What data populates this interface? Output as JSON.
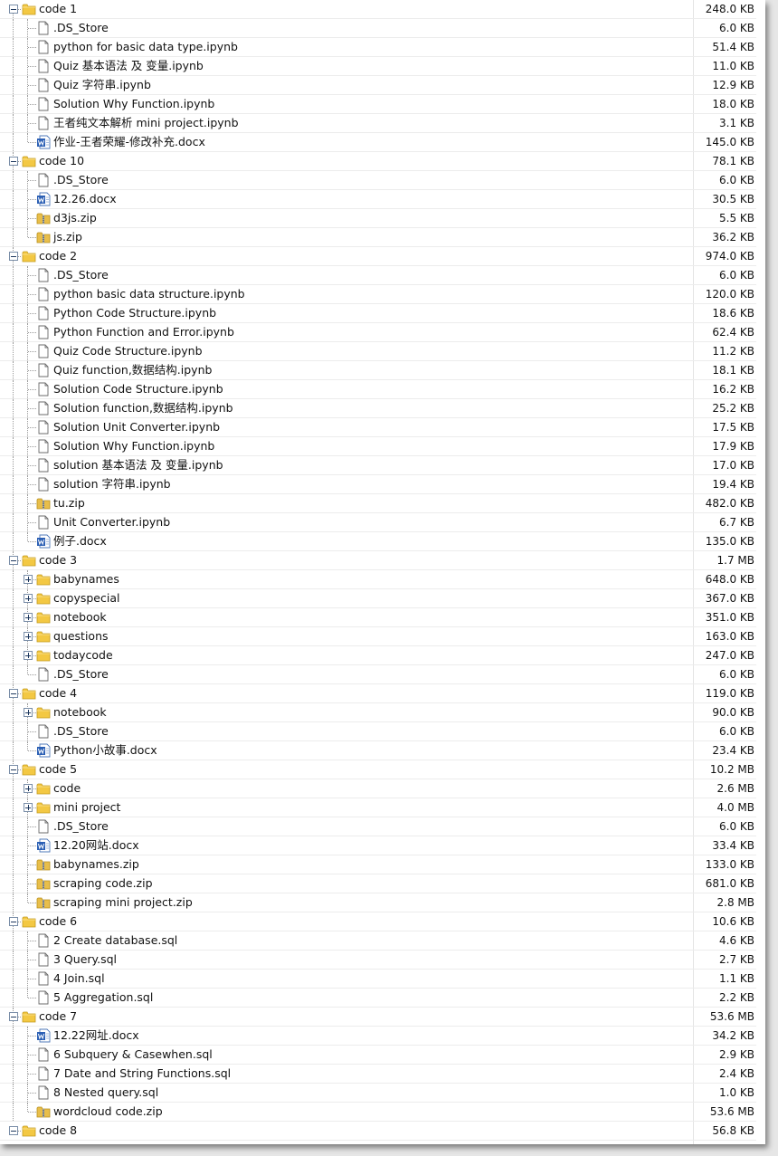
{
  "colors": {
    "folder": "#f3c843",
    "word_blue": "#2b5fb4",
    "zip": "#e8be4a"
  },
  "rows": [
    {
      "depth": 0,
      "kind": "folder",
      "exp": "minus",
      "name": "code 1",
      "size": "248.0 KB"
    },
    {
      "depth": 1,
      "kind": "file",
      "name": ".DS_Store",
      "size": "6.0 KB"
    },
    {
      "depth": 1,
      "kind": "file",
      "name": "python for basic data type.ipynb",
      "size": "51.4 KB"
    },
    {
      "depth": 1,
      "kind": "file",
      "name": "Quiz 基本语法 及 变量.ipynb",
      "size": "11.0 KB"
    },
    {
      "depth": 1,
      "kind": "file",
      "name": "Quiz 字符串.ipynb",
      "size": "12.9 KB"
    },
    {
      "depth": 1,
      "kind": "file",
      "name": "Solution Why Function.ipynb",
      "size": "18.0 KB"
    },
    {
      "depth": 1,
      "kind": "file",
      "name": "王者纯文本解析 mini project.ipynb",
      "size": "3.1 KB"
    },
    {
      "depth": 1,
      "kind": "word",
      "name": "作业-王者荣耀-修改补充.docx",
      "size": "145.0 KB"
    },
    {
      "depth": 0,
      "kind": "folder",
      "exp": "minus",
      "name": "code 10",
      "size": "78.1 KB"
    },
    {
      "depth": 1,
      "kind": "file",
      "name": ".DS_Store",
      "size": "6.0 KB"
    },
    {
      "depth": 1,
      "kind": "word",
      "name": "12.26.docx",
      "size": "30.5 KB"
    },
    {
      "depth": 1,
      "kind": "zip",
      "name": "d3js.zip",
      "size": "5.5 KB"
    },
    {
      "depth": 1,
      "kind": "zip",
      "name": "js.zip",
      "size": "36.2 KB"
    },
    {
      "depth": 0,
      "kind": "folder",
      "exp": "minus",
      "name": "code 2",
      "size": "974.0 KB"
    },
    {
      "depth": 1,
      "kind": "file",
      "name": ".DS_Store",
      "size": "6.0 KB"
    },
    {
      "depth": 1,
      "kind": "file",
      "name": "python basic data structure.ipynb",
      "size": "120.0 KB"
    },
    {
      "depth": 1,
      "kind": "file",
      "name": "Python Code Structure.ipynb",
      "size": "18.6 KB"
    },
    {
      "depth": 1,
      "kind": "file",
      "name": "Python Function and Error.ipynb",
      "size": "62.4 KB"
    },
    {
      "depth": 1,
      "kind": "file",
      "name": "Quiz Code Structure.ipynb",
      "size": "11.2 KB"
    },
    {
      "depth": 1,
      "kind": "file",
      "name": "Quiz function,数据结构.ipynb",
      "size": "18.1 KB"
    },
    {
      "depth": 1,
      "kind": "file",
      "name": "Solution Code Structure.ipynb",
      "size": "16.2 KB"
    },
    {
      "depth": 1,
      "kind": "file",
      "name": "Solution function,数据结构.ipynb",
      "size": "25.2 KB"
    },
    {
      "depth": 1,
      "kind": "file",
      "name": "Solution Unit Converter.ipynb",
      "size": "17.5 KB"
    },
    {
      "depth": 1,
      "kind": "file",
      "name": "Solution Why Function.ipynb",
      "size": "17.9 KB"
    },
    {
      "depth": 1,
      "kind": "file",
      "name": "solution 基本语法 及 变量.ipynb",
      "size": "17.0 KB"
    },
    {
      "depth": 1,
      "kind": "file",
      "name": "solution 字符串.ipynb",
      "size": "19.4 KB"
    },
    {
      "depth": 1,
      "kind": "zip",
      "name": "tu.zip",
      "size": "482.0 KB"
    },
    {
      "depth": 1,
      "kind": "file",
      "name": "Unit Converter.ipynb",
      "size": "6.7 KB"
    },
    {
      "depth": 1,
      "kind": "word",
      "name": "例子.docx",
      "size": "135.0 KB"
    },
    {
      "depth": 0,
      "kind": "folder",
      "exp": "minus",
      "name": "code 3",
      "size": "1.7 MB"
    },
    {
      "depth": 1,
      "kind": "folder",
      "exp": "plus",
      "name": "babynames",
      "size": "648.0 KB"
    },
    {
      "depth": 1,
      "kind": "folder",
      "exp": "plus",
      "name": "copyspecial",
      "size": "367.0 KB"
    },
    {
      "depth": 1,
      "kind": "folder",
      "exp": "plus",
      "name": "notebook",
      "size": "351.0 KB"
    },
    {
      "depth": 1,
      "kind": "folder",
      "exp": "plus",
      "name": "questions",
      "size": "163.0 KB"
    },
    {
      "depth": 1,
      "kind": "folder",
      "exp": "plus",
      "name": "todaycode",
      "size": "247.0 KB"
    },
    {
      "depth": 1,
      "kind": "file",
      "name": ".DS_Store",
      "size": "6.0 KB"
    },
    {
      "depth": 0,
      "kind": "folder",
      "exp": "minus",
      "name": "code 4",
      "size": "119.0 KB"
    },
    {
      "depth": 1,
      "kind": "folder",
      "exp": "plus",
      "name": "notebook",
      "size": "90.0 KB"
    },
    {
      "depth": 1,
      "kind": "file",
      "name": ".DS_Store",
      "size": "6.0 KB"
    },
    {
      "depth": 1,
      "kind": "word",
      "name": "Python小故事.docx",
      "size": "23.4 KB"
    },
    {
      "depth": 0,
      "kind": "folder",
      "exp": "minus",
      "name": "code 5",
      "size": "10.2 MB"
    },
    {
      "depth": 1,
      "kind": "folder",
      "exp": "plus",
      "name": "code",
      "size": "2.6 MB"
    },
    {
      "depth": 1,
      "kind": "folder",
      "exp": "plus",
      "name": "mini project",
      "size": "4.0 MB"
    },
    {
      "depth": 1,
      "kind": "file",
      "name": ".DS_Store",
      "size": "6.0 KB"
    },
    {
      "depth": 1,
      "kind": "word",
      "name": "12.20网站.docx",
      "size": "33.4 KB"
    },
    {
      "depth": 1,
      "kind": "zip",
      "name": "babynames.zip",
      "size": "133.0 KB"
    },
    {
      "depth": 1,
      "kind": "zip",
      "name": "scraping code.zip",
      "size": "681.0 KB"
    },
    {
      "depth": 1,
      "kind": "zip",
      "name": "scraping mini project.zip",
      "size": "2.8 MB"
    },
    {
      "depth": 0,
      "kind": "folder",
      "exp": "minus",
      "name": "code 6",
      "size": "10.6 KB"
    },
    {
      "depth": 1,
      "kind": "file",
      "name": "2 Create database.sql",
      "size": "4.6 KB"
    },
    {
      "depth": 1,
      "kind": "file",
      "name": "3 Query.sql",
      "size": "2.7 KB"
    },
    {
      "depth": 1,
      "kind": "file",
      "name": "4 Join.sql",
      "size": "1.1 KB"
    },
    {
      "depth": 1,
      "kind": "file",
      "name": "5 Aggregation.sql",
      "size": "2.2 KB"
    },
    {
      "depth": 0,
      "kind": "folder",
      "exp": "minus",
      "name": "code 7",
      "size": "53.6 MB"
    },
    {
      "depth": 1,
      "kind": "word",
      "name": "12.22网址.docx",
      "size": "34.2 KB"
    },
    {
      "depth": 1,
      "kind": "file",
      "name": "6 Subquery & Casewhen.sql",
      "size": "2.9 KB"
    },
    {
      "depth": 1,
      "kind": "file",
      "name": "7 Date and String Functions.sql",
      "size": "2.4 KB"
    },
    {
      "depth": 1,
      "kind": "file",
      "name": "8 Nested query.sql",
      "size": "1.0 KB"
    },
    {
      "depth": 1,
      "kind": "zip",
      "name": "wordcloud code.zip",
      "size": "53.6 MB"
    },
    {
      "depth": 0,
      "kind": "folder",
      "exp": "minus",
      "name": "code 8",
      "size": "56.8 KB"
    }
  ]
}
